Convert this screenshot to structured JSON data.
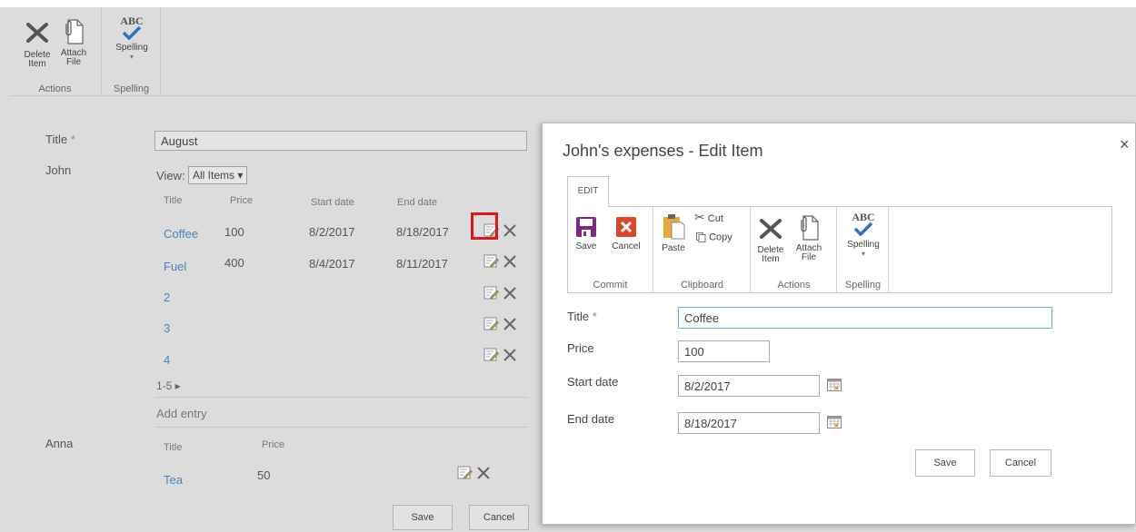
{
  "bg_ribbon": {
    "delete_label_1": "Delete",
    "delete_label_2": "Item",
    "attach_label_1": "Attach",
    "attach_label_2": "File",
    "spelling_icon_text": "ABC",
    "spelling_label": "Spelling",
    "group_actions": "Actions",
    "group_spelling": "Spelling"
  },
  "form": {
    "title_label": "Title",
    "required_mark": "*",
    "title_value": "August",
    "john_label": "John",
    "view_prefix": "View:",
    "view_value": "All Items ▾",
    "columns": [
      "Title",
      "Price",
      "Start date",
      "End date"
    ],
    "rows": [
      {
        "title": "Coffee",
        "price": "100",
        "start": "8/2/2017",
        "end": "8/18/2017"
      },
      {
        "title": "Fuel",
        "price": "400",
        "start": "8/4/2017",
        "end": "8/11/2017"
      },
      {
        "title": "2",
        "price": "",
        "start": "",
        "end": ""
      },
      {
        "title": "3",
        "price": "",
        "start": "",
        "end": ""
      },
      {
        "title": "4",
        "price": "",
        "start": "",
        "end": ""
      }
    ],
    "pager": "1-5 ▸",
    "add_entry": "Add entry",
    "anna_label": "Anna",
    "anna_columns": [
      "Title",
      "Price"
    ],
    "anna_rows": [
      {
        "title": "Tea",
        "price": "50"
      }
    ],
    "save_label": "Save",
    "cancel_label": "Cancel"
  },
  "dialog": {
    "title": "John's expenses - Edit Item",
    "close_glyph": "×",
    "tab_label": "EDIT",
    "ribbon": {
      "save": "Save",
      "cancel": "Cancel",
      "paste": "Paste",
      "cut": "Cut",
      "copy": "Copy",
      "delete_1": "Delete",
      "delete_2": "Item",
      "attach_1": "Attach",
      "attach_2": "File",
      "spelling_icon_text": "ABC",
      "spelling": "Spelling",
      "group_commit": "Commit",
      "group_clipboard": "Clipboard",
      "group_actions": "Actions",
      "group_spelling": "Spelling"
    },
    "fields": {
      "title_label": "Title",
      "required_mark": "*",
      "title_value": "Coffee",
      "price_label": "Price",
      "price_value": "100",
      "start_label": "Start date",
      "start_value": "8/2/2017",
      "end_label": "End date",
      "end_value": "8/18/2017"
    },
    "save_label": "Save",
    "cancel_label": "Cancel"
  },
  "colors": {
    "link": "#4d82c1",
    "highlight": "#e0151b",
    "save_icon": "#7b2a84",
    "cancel_icon": "#d9462a",
    "check": "#2f72c4"
  }
}
